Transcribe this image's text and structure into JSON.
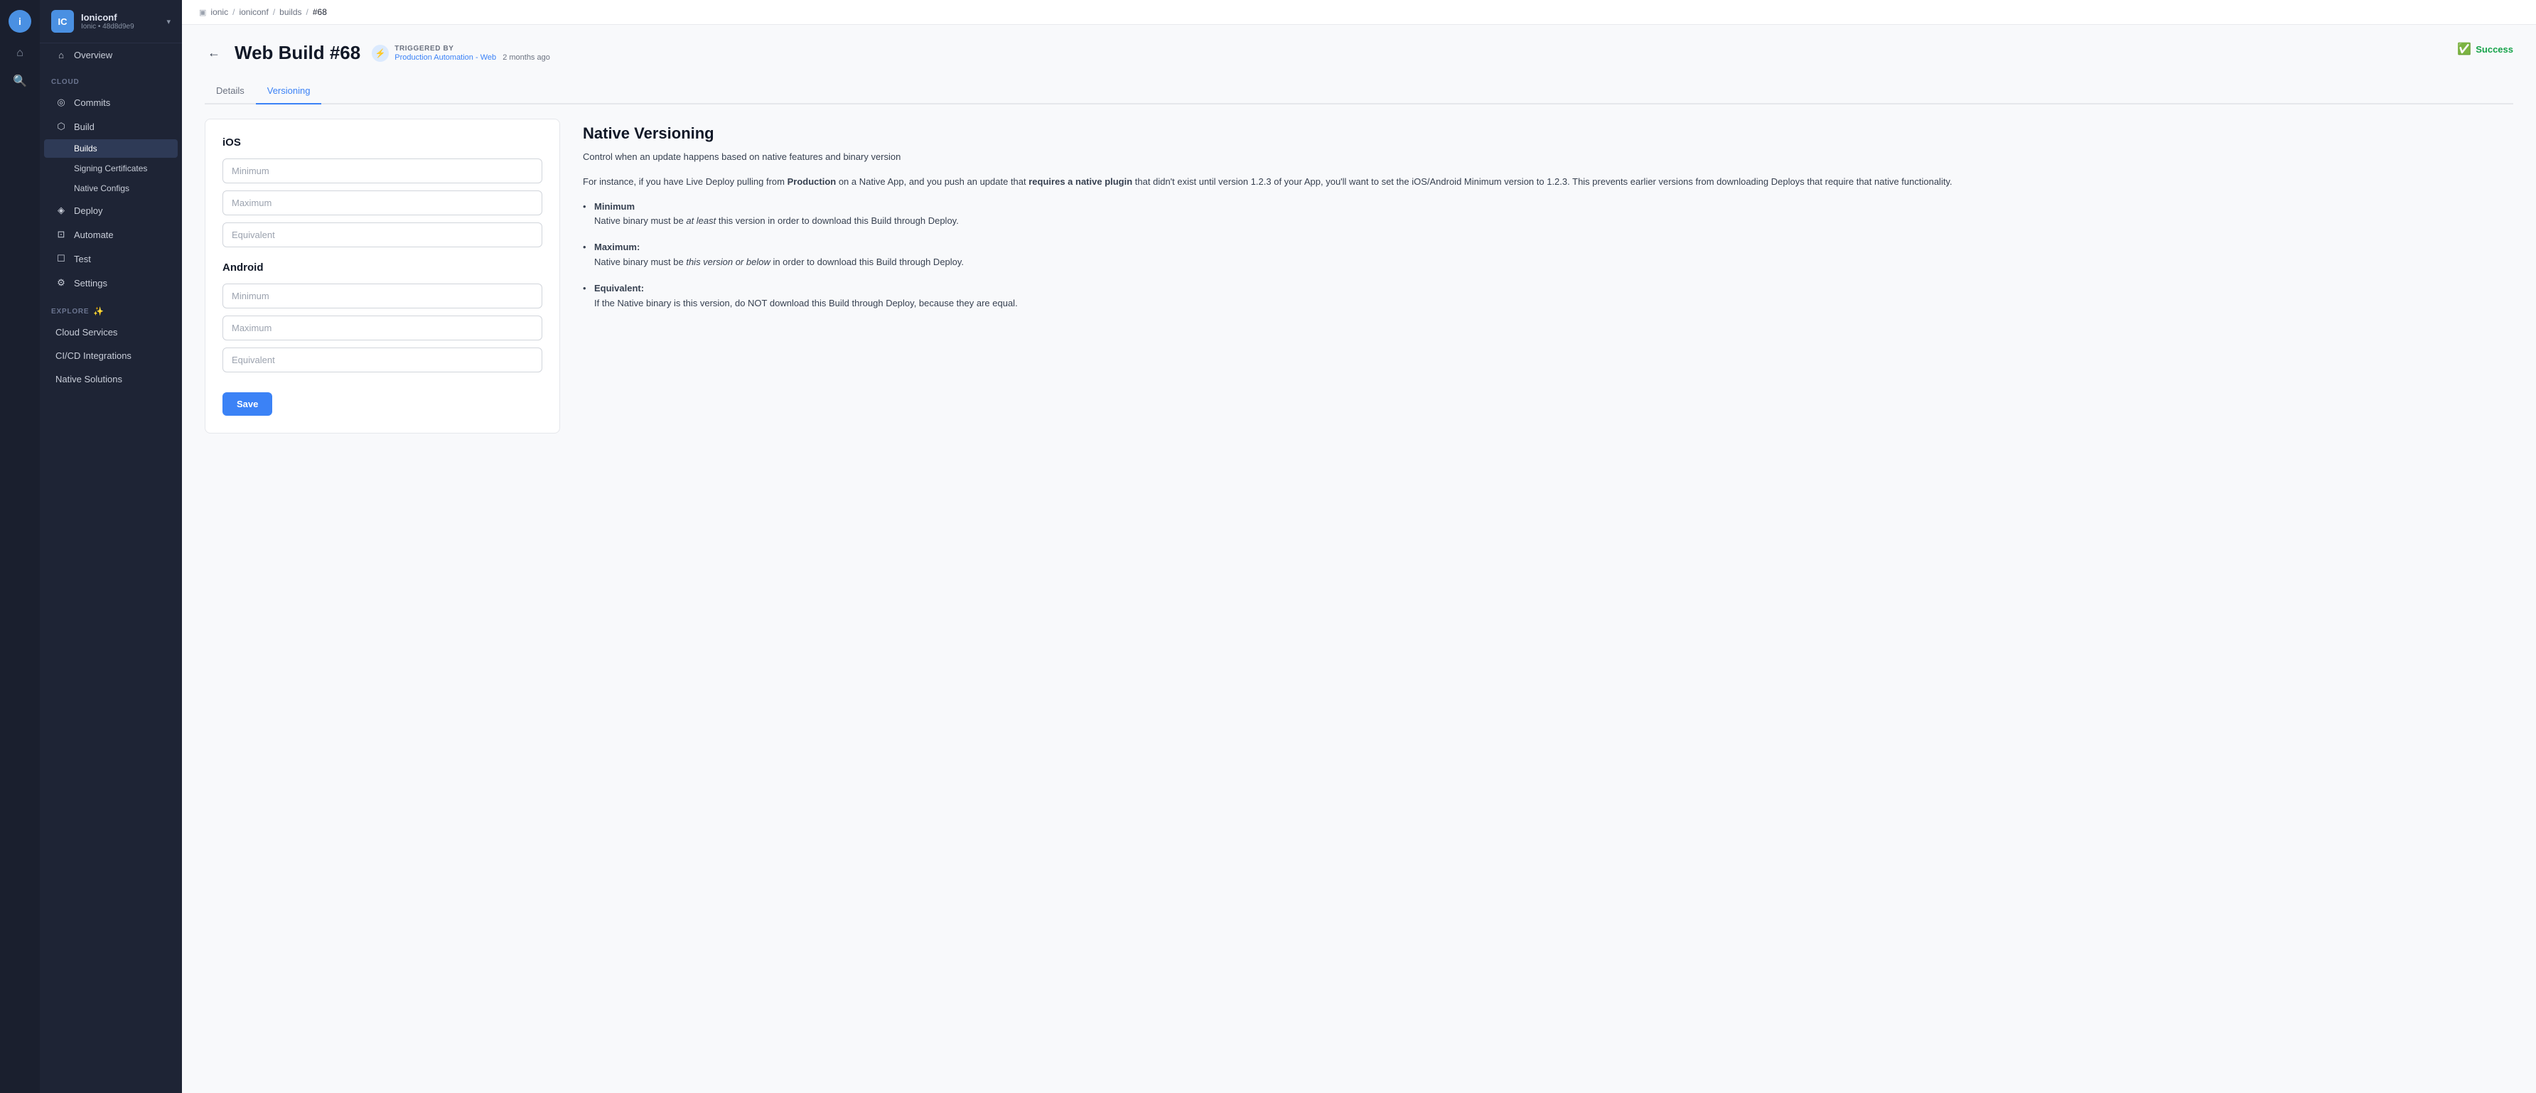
{
  "iconRail": {
    "logoText": "i"
  },
  "sidebar": {
    "appName": "Ioniconf",
    "appId": "Ionic • 48d8d9e9",
    "sectionCloud": "CLOUD",
    "sectionExplore": "EXPLORE",
    "items": [
      {
        "id": "overview",
        "label": "Overview",
        "icon": "⌂"
      },
      {
        "id": "commits",
        "label": "Commits",
        "icon": "◎"
      },
      {
        "id": "build",
        "label": "Build",
        "icon": "⬡"
      },
      {
        "id": "builds",
        "label": "Builds",
        "icon": "",
        "active": true,
        "sub": true
      },
      {
        "id": "signing-certificates",
        "label": "Signing Certificates",
        "icon": "",
        "sub": true
      },
      {
        "id": "native-configs",
        "label": "Native Configs",
        "icon": "",
        "sub": true
      },
      {
        "id": "deploy",
        "label": "Deploy",
        "icon": "◈"
      },
      {
        "id": "automate",
        "label": "Automate",
        "icon": "⊡"
      },
      {
        "id": "test",
        "label": "Test",
        "icon": "☐"
      },
      {
        "id": "settings",
        "label": "Settings",
        "icon": "⚙"
      },
      {
        "id": "cloud-services",
        "label": "Cloud Services",
        "icon": ""
      },
      {
        "id": "cicd-integrations",
        "label": "CI/CD Integrations",
        "icon": ""
      },
      {
        "id": "native-solutions",
        "label": "Native Solutions",
        "icon": ""
      }
    ]
  },
  "breadcrumb": {
    "items": [
      "ionic",
      "ioniconf",
      "builds",
      "#68"
    ]
  },
  "header": {
    "title": "Web Build #68",
    "triggeredByLabel": "TRIGGERED BY",
    "triggerLink": "Production Automation - Web",
    "triggerTime": "2 months ago",
    "statusLabel": "Success"
  },
  "tabs": [
    {
      "id": "details",
      "label": "Details"
    },
    {
      "id": "versioning",
      "label": "Versioning",
      "active": true
    }
  ],
  "form": {
    "iosSectionTitle": "iOS",
    "androidSectionTitle": "Android",
    "fields": {
      "iosMinimumPlaceholder": "Minimum",
      "iosMaximumPlaceholder": "Maximum",
      "iosEquivalentPlaceholder": "Equivalent",
      "androidMinimumPlaceholder": "Minimum",
      "androidMaximumPlaceholder": "Maximum",
      "androidEquivalentPlaceholder": "Equivalent"
    },
    "saveLabel": "Save"
  },
  "infoPanel": {
    "title": "Native Versioning",
    "description1": "Control when an update happens based on native features and binary version",
    "description2Start": "For instance, if you have Live Deploy pulling from ",
    "description2Bold": "Production",
    "description2Mid": " on a Native App, and you push an update that ",
    "description2Bold2": "requires a native plugin",
    "description2End": " that didn't exist until version 1.2.3 of your App, you'll want to set the iOS/Android Minimum version to 1.2.3. This prevents earlier versions from downloading Deploys that require that native functionality.",
    "bullets": [
      {
        "title": "Minimum",
        "body": "Native binary must be ",
        "italic": "at least",
        "bodyEnd": " this version in order to download this Build through Deploy."
      },
      {
        "title": "Maximum:",
        "body": "Native binary must be ",
        "italic": "this version or below",
        "bodyEnd": " in order to download this Build through Deploy."
      },
      {
        "title": "Equivalent:",
        "body": "If the Native binary is this version, do NOT download this Build through Deploy, because they are equal."
      }
    ]
  }
}
